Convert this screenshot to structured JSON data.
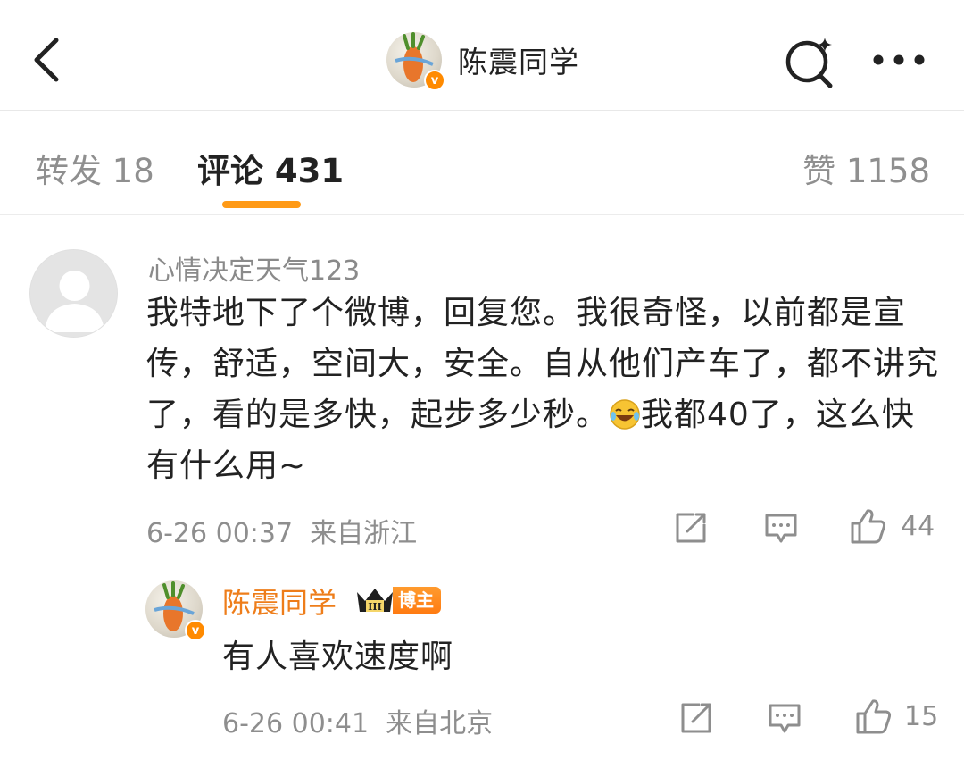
{
  "header": {
    "back_icon": "chevron-left-icon",
    "author_name": "陈震同学",
    "search_icon": "search-sparkle-icon",
    "more_icon": "more-dots-icon",
    "verified_mark": "v"
  },
  "tabs": [
    {
      "label": "转发 18"
    },
    {
      "label": "评论 431"
    },
    {
      "label": "赞 1158"
    }
  ],
  "accent_color": "#ff9a16",
  "comment": {
    "user": "心情决定天气123",
    "text_part1": "我特地下了个微博，回复您。我很奇怪，以前都是宣传，舒适，空间大，安全。自从他们产车了，都不讲究了，看的是多快，起步多少秒。",
    "emoji": "laughing-crying-emoji",
    "text_part2": "我都40了，这么快有什么用~",
    "time": "6-26 00:37",
    "location": "来自浙江",
    "likes": "44"
  },
  "reply": {
    "user": "陈震同学",
    "badge_level": "III",
    "badge_label": "博主",
    "text": "有人喜欢速度啊",
    "time": "6-26 00:41",
    "location": "来自北京",
    "likes": "15"
  }
}
